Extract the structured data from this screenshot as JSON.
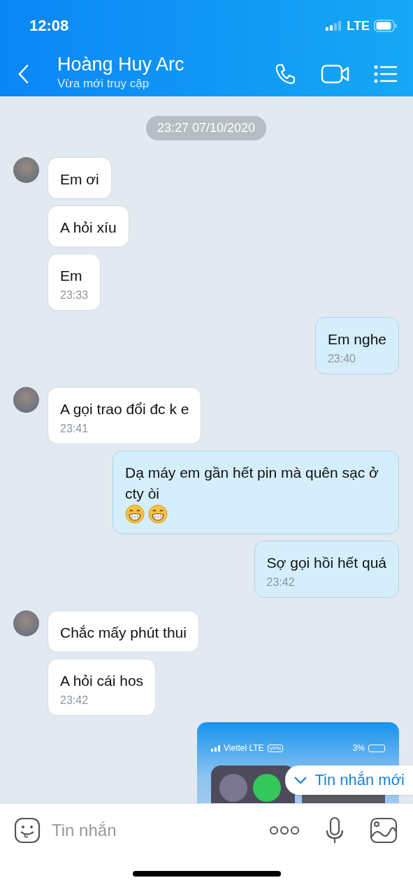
{
  "status_bar": {
    "time": "12:08",
    "network": "LTE"
  },
  "header": {
    "title": "Hoàng Huy Arc",
    "subtitle": "Vừa mới truy cập"
  },
  "date_divider": "23:27 07/10/2020",
  "messages": [
    {
      "kind": "text",
      "outgoing": false,
      "avatar": true,
      "text": "Em ơi"
    },
    {
      "kind": "text",
      "outgoing": false,
      "avatar": false,
      "text": "A hỏi xíu"
    },
    {
      "kind": "text",
      "outgoing": false,
      "avatar": false,
      "text": "Em",
      "time": "23:33"
    },
    {
      "kind": "text",
      "outgoing": true,
      "avatar": false,
      "text": "Em nghe",
      "time": "23:40"
    },
    {
      "kind": "text",
      "outgoing": false,
      "avatar": true,
      "text": "A gọi trao đổi đc k e",
      "time": "23:41"
    },
    {
      "kind": "text",
      "outgoing": true,
      "avatar": false,
      "text": "Dạ máy em gần hết pin mà quên sạc ở cty òi",
      "emojis": [
        {
          "kind": "grin"
        },
        {
          "kind": "grin"
        }
      ]
    },
    {
      "kind": "text",
      "outgoing": true,
      "avatar": false,
      "text": "Sợ gọi hồi hết quá",
      "time": "23:42"
    },
    {
      "kind": "text",
      "outgoing": false,
      "avatar": true,
      "text": "Chắc mấy phút thui"
    },
    {
      "kind": "text",
      "outgoing": false,
      "avatar": false,
      "text": "A hỏi cái hos",
      "time": "23:42"
    },
    {
      "kind": "image",
      "outgoing": true,
      "avatar": false,
      "screenshot": {
        "carrier": "Viettel LTE",
        "vpn": "VPN",
        "battery": "3%"
      }
    }
  ],
  "new_messages_pill": "Tin nhắn mới",
  "composer": {
    "placeholder": "Tin nhắn"
  }
}
